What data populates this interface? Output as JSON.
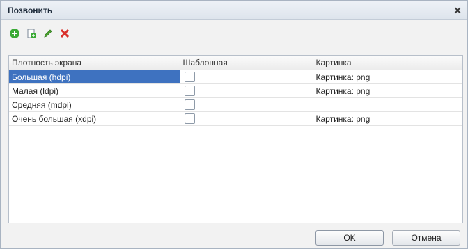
{
  "window": {
    "title": "Позвонить"
  },
  "toolbar": {
    "buttons": [
      {
        "icon": "add-circle-icon",
        "color": "#3aaa35"
      },
      {
        "icon": "copy-doc-icon",
        "color": "#5aa0d8"
      },
      {
        "icon": "pencil-icon",
        "color": "#4da530"
      },
      {
        "icon": "delete-x-icon",
        "color": "#d9302b"
      }
    ]
  },
  "table": {
    "columns": [
      "Плотность экрана",
      "Шаблонная",
      "Картинка"
    ],
    "rows": [
      {
        "density": "Большая (hdpi)",
        "template": false,
        "picture": "Картинка: png",
        "selected": true
      },
      {
        "density": "Малая (ldpi)",
        "template": false,
        "picture": "Картинка: png",
        "selected": false
      },
      {
        "density": "Средняя (mdpi)",
        "template": false,
        "picture": "",
        "selected": false
      },
      {
        "density": "Очень большая (xdpi)",
        "template": false,
        "picture": "Картинка: png",
        "selected": false
      }
    ]
  },
  "footer": {
    "ok_label": "OK",
    "cancel_label": "Отмена"
  },
  "colors": {
    "selection": "#3e72c0",
    "titlebar": "#dde4ec"
  }
}
